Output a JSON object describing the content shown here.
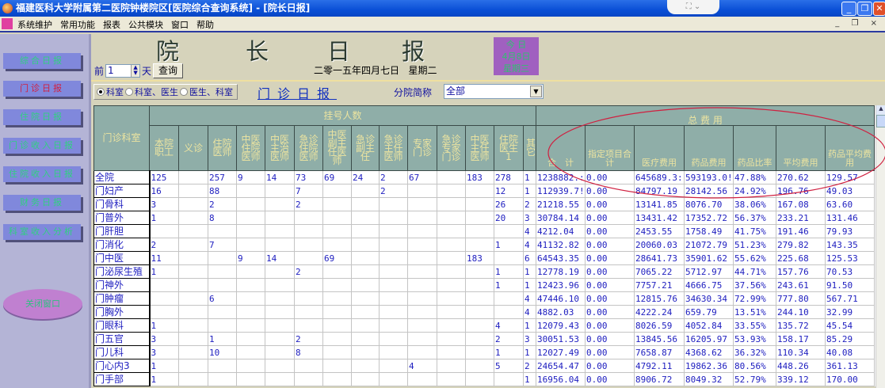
{
  "window": {
    "title": "福建医科大学附属第二医院钟楼院区[医院综合查询系统] - [院长日报]",
    "min": "_",
    "restore": "❐",
    "close": "✕",
    "pill": "⛶ ⌄"
  },
  "menu": [
    "系统维护",
    "常用功能",
    "报表",
    "公共模块",
    "窗口",
    "帮助"
  ],
  "mdi_controls": "_ ❐ ×",
  "sidebar": {
    "items": [
      {
        "label": "综合日报",
        "active": false
      },
      {
        "label": "门诊日报",
        "active": true
      },
      {
        "label": "住院日报",
        "active": false
      },
      {
        "label": "门诊收入日报",
        "active": false
      },
      {
        "label": "住院收入日报",
        "active": false
      },
      {
        "label": "财务日报",
        "active": false
      },
      {
        "label": "科室收入分析",
        "active": false
      }
    ],
    "close": "关闭窗口"
  },
  "header": {
    "title_chars": [
      "院",
      "长",
      "日",
      "报"
    ],
    "date": "二零一五年四月七日",
    "weekday": "星期二",
    "today": [
      "今 日",
      "4月8日",
      "星期三"
    ],
    "prev_label": "前",
    "days_value": "1",
    "days_unit": "天",
    "query": "查询"
  },
  "filters": {
    "radios": [
      {
        "label": "科室",
        "checked": true
      },
      {
        "label": "科室、医生",
        "checked": false
      },
      {
        "label": "医生、科室",
        "checked": false
      }
    ],
    "report_link": "门诊日报",
    "branch_label": "分院简称",
    "branch_value": "全部"
  },
  "table": {
    "dept_header": "门诊科室",
    "reg_group": "挂号人数",
    "fee_group": "总 费 用",
    "reg_columns": [
      "本院职工",
      "义诊",
      "住院医师",
      "中医住院医师",
      "中医主治医师",
      "急诊住院医师",
      "中医副主任医师",
      "急诊副主任",
      "急诊主任医师",
      "专家门诊",
      "急诊专家门诊",
      "中医主任医师",
      "住院医生1",
      "其它"
    ],
    "fee_columns": [
      "合　计",
      "指定项目合计",
      "医疗费用",
      "药品费用",
      "药品比率",
      "平均费用",
      "药品平均费用"
    ],
    "rows": [
      {
        "dept": "全院",
        "reg": [
          "125",
          "",
          "257",
          "9",
          "14",
          "73",
          "69",
          "24",
          "2",
          "67",
          "",
          "183",
          "278",
          "1"
        ],
        "fee": [
          "1238882.:",
          "0.00",
          "645689.3:",
          "593193.0!",
          "47.88%",
          "270.62",
          "129.57"
        ]
      },
      {
        "dept": "门妇产",
        "reg": [
          "16",
          "",
          "88",
          "",
          "",
          "7",
          "",
          "",
          "2",
          "",
          "",
          "",
          "12",
          "1"
        ],
        "fee": [
          "112939.7!",
          "0.00",
          "84797.19",
          "28142.56",
          "24.92%",
          "196.76",
          "49.03"
        ]
      },
      {
        "dept": "门骨科",
        "reg": [
          "3",
          "",
          "2",
          "",
          "",
          "2",
          "",
          "",
          "",
          "",
          "",
          "",
          "26",
          "2"
        ],
        "fee": [
          "21218.55",
          "0.00",
          "13141.85",
          "8076.70",
          "38.06%",
          "167.08",
          "63.60"
        ]
      },
      {
        "dept": "门普外",
        "reg": [
          "1",
          "",
          "8",
          "",
          "",
          "",
          "",
          "",
          "",
          "",
          "",
          "",
          "20",
          "3"
        ],
        "fee": [
          "30784.14",
          "0.00",
          "13431.42",
          "17352.72",
          "56.37%",
          "233.21",
          "131.46"
        ]
      },
      {
        "dept": "门肝胆",
        "reg": [
          "",
          "",
          "",
          "",
          "",
          "",
          "",
          "",
          "",
          "",
          "",
          "",
          "",
          "4"
        ],
        "fee": [
          "4212.04",
          "0.00",
          "2453.55",
          "1758.49",
          "41.75%",
          "191.46",
          "79.93"
        ]
      },
      {
        "dept": "门消化",
        "reg": [
          "2",
          "",
          "7",
          "",
          "",
          "",
          "",
          "",
          "",
          "",
          "",
          "",
          "1",
          "4"
        ],
        "fee": [
          "41132.82",
          "0.00",
          "20060.03",
          "21072.79",
          "51.23%",
          "279.82",
          "143.35"
        ]
      },
      {
        "dept": "门中医",
        "reg": [
          "11",
          "",
          "",
          "9",
          "14",
          "",
          "69",
          "",
          "",
          "",
          "",
          "183",
          "",
          "6"
        ],
        "fee": [
          "64543.35",
          "0.00",
          "28641.73",
          "35901.62",
          "55.62%",
          "225.68",
          "125.53"
        ]
      },
      {
        "dept": "门泌尿生殖",
        "reg": [
          "1",
          "",
          "",
          "",
          "",
          "2",
          "",
          "",
          "",
          "",
          "",
          "",
          "1",
          "1"
        ],
        "fee": [
          "12778.19",
          "0.00",
          "7065.22",
          "5712.97",
          "44.71%",
          "157.76",
          "70.53"
        ]
      },
      {
        "dept": "门神外",
        "reg": [
          "",
          "",
          "",
          "",
          "",
          "",
          "",
          "",
          "",
          "",
          "",
          "",
          "1",
          "1"
        ],
        "fee": [
          "12423.96",
          "0.00",
          "7757.21",
          "4666.75",
          "37.56%",
          "243.61",
          "91.50"
        ]
      },
      {
        "dept": "门肿瘤",
        "reg": [
          "",
          "",
          "6",
          "",
          "",
          "",
          "",
          "",
          "",
          "",
          "",
          "",
          "",
          "4"
        ],
        "fee": [
          "47446.10",
          "0.00",
          "12815.76",
          "34630.34",
          "72.99%",
          "777.80",
          "567.71"
        ]
      },
      {
        "dept": "门胸外",
        "reg": [
          "",
          "",
          "",
          "",
          "",
          "",
          "",
          "",
          "",
          "",
          "",
          "",
          "",
          "4"
        ],
        "fee": [
          "4882.03",
          "0.00",
          "4222.24",
          "659.79",
          "13.51%",
          "244.10",
          "32.99"
        ]
      },
      {
        "dept": "门眼科",
        "reg": [
          "1",
          "",
          "",
          "",
          "",
          "",
          "",
          "",
          "",
          "",
          "",
          "",
          "4",
          "1"
        ],
        "fee": [
          "12079.43",
          "0.00",
          "8026.59",
          "4052.84",
          "33.55%",
          "135.72",
          "45.54"
        ]
      },
      {
        "dept": "门五官",
        "reg": [
          "3",
          "",
          "1",
          "",
          "",
          "2",
          "",
          "",
          "",
          "",
          "",
          "",
          "2",
          "3"
        ],
        "fee": [
          "30051.53",
          "0.00",
          "13845.56",
          "16205.97",
          "53.93%",
          "158.17",
          "85.29"
        ]
      },
      {
        "dept": "门儿科",
        "reg": [
          "3",
          "",
          "10",
          "",
          "",
          "8",
          "",
          "",
          "",
          "",
          "",
          "",
          "1",
          "1"
        ],
        "fee": [
          "12027.49",
          "0.00",
          "7658.87",
          "4368.62",
          "36.32%",
          "110.34",
          "40.08"
        ]
      },
      {
        "dept": "门心内3",
        "reg": [
          "1",
          "",
          "",
          "",
          "",
          "",
          "",
          "",
          "",
          "4",
          "",
          "",
          "5",
          "2"
        ],
        "fee": [
          "24654.47",
          "0.00",
          "4792.11",
          "19862.36",
          "80.56%",
          "448.26",
          "361.13"
        ]
      },
      {
        "dept": "门手部",
        "reg": [
          "1",
          "",
          "",
          "",
          "",
          "",
          "",
          "",
          "",
          "",
          "",
          "",
          "",
          "1"
        ],
        "fee": [
          "16956.04",
          "0.00",
          "8906.72",
          "8049.32",
          "52.79%",
          "339.12",
          "170.00"
        ]
      }
    ]
  },
  "colors": {
    "annotation": "#d02040",
    "header_bg": "#8faea8",
    "cell_text": "#2020c0"
  }
}
